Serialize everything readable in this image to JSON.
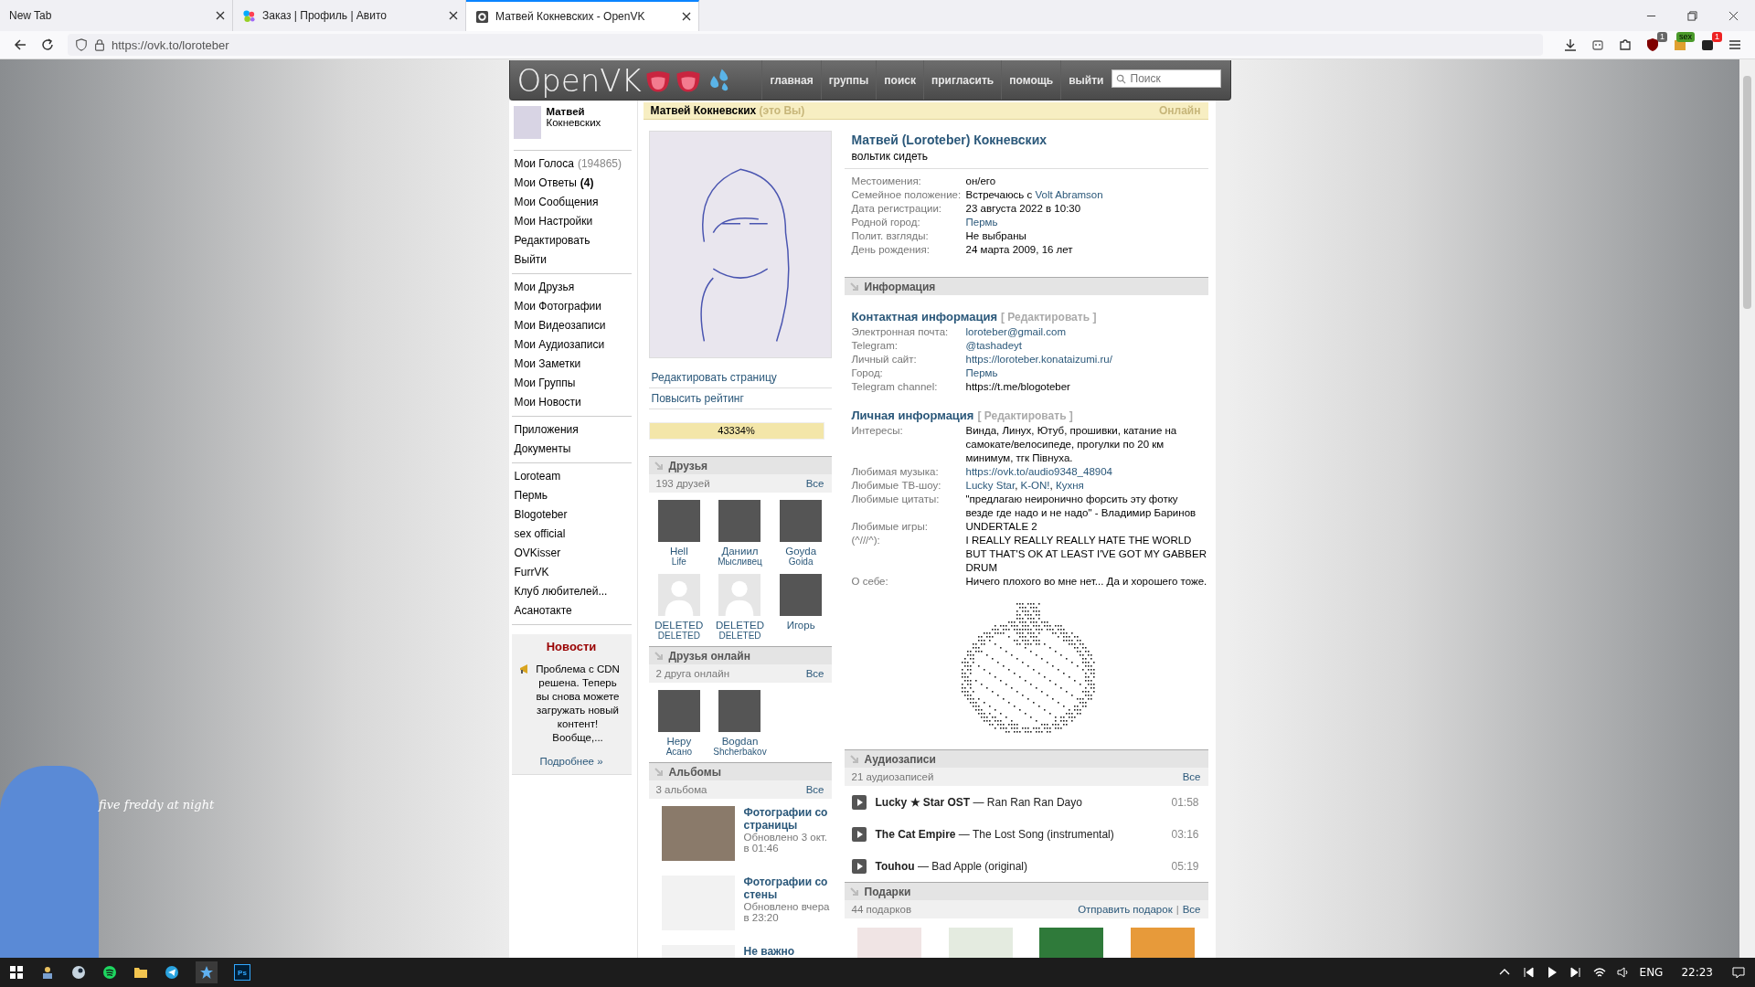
{
  "browser": {
    "tabs": [
      {
        "title": "New Tab",
        "selected": false
      },
      {
        "title": "Заказ | Профиль | Авито",
        "selected": false
      },
      {
        "title": "Матвей Кокневских - OpenVK",
        "selected": true
      }
    ],
    "url": "https://ovk.to/loroteber",
    "extension_badges": [
      "1",
      "sex",
      "1"
    ]
  },
  "desktop": {
    "caption": "five freddy at night"
  },
  "header": {
    "logo": "OpenVK",
    "nav": [
      "главная",
      "группы",
      "поиск",
      "пригласить",
      "помощь",
      "выйти"
    ],
    "search": {
      "placeholder": "Поиск"
    }
  },
  "sidebar": {
    "user": {
      "first_name": "Матвей",
      "last_name": "Кокневских"
    },
    "menu_groups": [
      [
        {
          "label": "Мои Голоса",
          "count": "(194865)",
          "kind": "muted"
        },
        {
          "label": "Мои Ответы",
          "count": "(4)",
          "kind": "bold"
        },
        {
          "label": "Мои Сообщения"
        },
        {
          "label": "Мои Настройки"
        },
        {
          "label": "Редактировать"
        },
        {
          "label": "Выйти"
        }
      ],
      [
        {
          "label": "Мои Друзья"
        },
        {
          "label": "Мои Фотографии"
        },
        {
          "label": "Мои Видеозаписи"
        },
        {
          "label": "Мои Аудиозаписи"
        },
        {
          "label": "Мои Заметки"
        },
        {
          "label": "Мои Группы"
        },
        {
          "label": "Мои Новости"
        }
      ],
      [
        {
          "label": "Приложения"
        },
        {
          "label": "Документы"
        }
      ],
      [
        {
          "label": "Loroteam"
        },
        {
          "label": "Пермь"
        },
        {
          "label": "Blogoteber"
        },
        {
          "label": "sex official"
        },
        {
          "label": "OVKisser"
        },
        {
          "label": "FurrVK"
        },
        {
          "label": "Клуб любителей..."
        },
        {
          "label": "Асанотакте"
        }
      ]
    ],
    "news": {
      "title": "Новости",
      "text": "Проблема с CDN решена. Теперь вы снова можете загружать новый контент! Вообще,...",
      "more": "Подробнее »"
    }
  },
  "profile": {
    "name": "Матвей Кокневских",
    "self_note": "(это Вы)",
    "status": "Онлайн"
  },
  "left_column": {
    "actions": [
      "Редактировать страницу",
      "Повысить рейтинг"
    ],
    "rating": {
      "text": "43334%",
      "level": 1
    },
    "friends": {
      "title": "Друзья",
      "count": "193 друзей",
      "all": "Все",
      "items": [
        {
          "first": "Hell",
          "last": "Life",
          "kind": "photo"
        },
        {
          "first": "Даниил",
          "last": "Мысливец",
          "kind": "photo"
        },
        {
          "first": "Goyda",
          "last": "Goida",
          "kind": "photo"
        },
        {
          "first": "DELETED",
          "last": "DELETED",
          "kind": "silhouette"
        },
        {
          "first": "DELETED",
          "last": "DELETED",
          "kind": "silhouette"
        },
        {
          "first": "Игорь",
          "kind": "photo"
        }
      ]
    },
    "online": {
      "title": "Друзья онлайн",
      "count": "2 друга онлайн",
      "all": "Все",
      "items": [
        {
          "first": "Hepy",
          "last": "Асано",
          "kind": "photo"
        },
        {
          "first": "Bogdan",
          "last": "Shcherbakov",
          "kind": "photo"
        }
      ]
    },
    "albums": {
      "title": "Альбомы",
      "count": "3 альбома",
      "all": "Все",
      "items": [
        {
          "title": "Фотографии со страницы",
          "updated": "Обновлено 3 окт. в 01:46"
        },
        {
          "title": "Фотографии со стены",
          "updated": "Обновлено вчера в 23:20"
        },
        {
          "title": "Не важно"
        }
      ]
    }
  },
  "right_column": {
    "full_name": "Матвей (Loroteber) Кокневских",
    "status_text": "вольтик сидеть",
    "fields": [
      {
        "label": "Местоимения:",
        "parts": [
          {
            "text": "он/его",
            "link": false
          }
        ]
      },
      {
        "label": "Семейное положение:",
        "parts": [
          {
            "text": "Встречаюсь с ",
            "link": false
          },
          {
            "text": "Volt Abramson",
            "link": true
          }
        ]
      },
      {
        "label": "Дата регистрации:",
        "parts": [
          {
            "text": "23 августа 2022 в 10:30",
            "link": false
          }
        ]
      },
      {
        "label": "Родной город:",
        "parts": [
          {
            "text": "Пермь",
            "link": true
          }
        ]
      },
      {
        "label": "Полит. взгляды:",
        "parts": [
          {
            "text": "Не выбраны",
            "link": false
          }
        ]
      },
      {
        "label": "День рождения:",
        "parts": [
          {
            "text": "24 марта 2009, 16 лет",
            "link": false
          }
        ]
      }
    ],
    "info": {
      "title": "Информация",
      "groups": [
        {
          "title": "Контактная информация",
          "edit": "[ Редактировать ]",
          "fields": [
            {
              "label": "Электронная почта:",
              "parts": [
                {
                  "text": "loroteber@gmail.com",
                  "link": true
                }
              ]
            },
            {
              "label": "Telegram:",
              "parts": [
                {
                  "text": "@tashadeyt",
                  "link": true
                }
              ]
            },
            {
              "label": "Личный сайт:",
              "parts": [
                {
                  "text": "https://loroteber.konataizumi.ru/",
                  "link": true
                }
              ]
            },
            {
              "label": "Город:",
              "parts": [
                {
                  "text": "Пермь",
                  "link": true
                }
              ]
            },
            {
              "label": "Telegram channel:",
              "parts": [
                {
                  "text": "https://t.me/blogoteber",
                  "link": false
                }
              ]
            }
          ]
        },
        {
          "title": "Личная информация",
          "edit": "[ Редактировать ]",
          "fields": [
            {
              "label": "Интересы:",
              "parts": [
                {
                  "text": "Винда, Линух, Ютуб, прошивки, катание на самокате/велосипеде, прогулки по 20 км минимум, тгк Півнуха.",
                  "link": false
                }
              ]
            },
            {
              "label": "Любимая музыка:",
              "parts": [
                {
                  "text": "https://ovk.to/audio9348_48904",
                  "link": true
                }
              ]
            },
            {
              "label": "Любимые ТВ-шоу:",
              "parts": [
                {
                  "text": "Lucky Star",
                  "link": true
                },
                {
                  "text": ", ",
                  "link": false
                },
                {
                  "text": "K-ON!",
                  "link": true
                },
                {
                  "text": ", ",
                  "link": false
                },
                {
                  "text": "Кухня",
                  "link": true
                }
              ]
            },
            {
              "label": "Любимые цитаты:",
              "parts": [
                {
                  "text": "\"предлагаю неиронично форсить эту фотку везде где надо и не надо\" - Владимир Баринов",
                  "link": false
                }
              ]
            },
            {
              "label": "Любимые игры:",
              "parts": [
                {
                  "text": "UNDERTALE 2",
                  "link": false
                }
              ]
            },
            {
              "label": "(^///^):",
              "parts": [
                {
                  "text": "I REALLY REALLY REALLY HATE THE WORLD BUT THAT'S OK AT LEAST I'VE GOT MY GABBER DRUM",
                  "link": false
                }
              ]
            },
            {
              "label": "О себе:",
              "parts": [
                {
                  "text": "Ничего плохого во мне нет... Да и хорошего тоже.",
                  "link": false
                }
              ]
            }
          ]
        }
      ]
    },
    "audio": {
      "title": "Аудиозаписи",
      "count": "21 аудиозаписей",
      "all": "Все",
      "tracks": [
        {
          "artist": "Lucky ★ Star OST",
          "dash": "—",
          "title": "Ran Ran Ran Dayo",
          "duration": "01:58"
        },
        {
          "artist": "The Cat Empire",
          "dash": "—",
          "title": "The Lost Song (instrumental)",
          "duration": "03:16"
        },
        {
          "artist": "Touhou",
          "dash": "—",
          "title": "Bad Apple (original)",
          "duration": "05:19"
        }
      ]
    },
    "gifts": {
      "title": "Подарки",
      "count": "44 подарков",
      "send": "Отправить подарок",
      "separator": "|",
      "all": "Все"
    }
  },
  "taskbar": {
    "photo_editor_label": "Ps",
    "language": "ENG",
    "time": "22:23"
  }
}
